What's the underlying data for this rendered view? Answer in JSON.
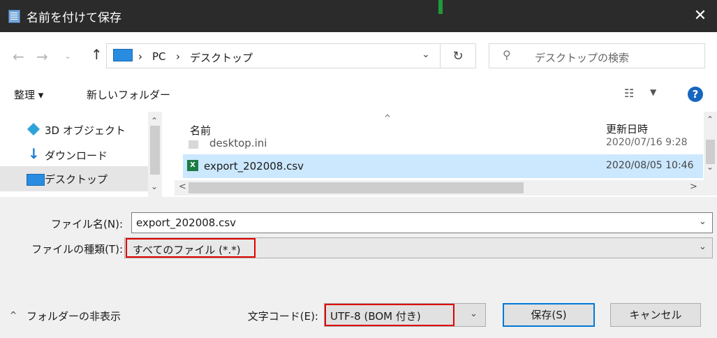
{
  "window": {
    "title": "名前を付けて保存",
    "close_label": "✕"
  },
  "address": {
    "crumbs": [
      "PC",
      "デスクトップ"
    ],
    "separator": "›"
  },
  "search": {
    "placeholder": "デスクトップの検索"
  },
  "toolbar": {
    "organize": "整理 ▾",
    "new_folder": "新しいフォルダー",
    "help": "?"
  },
  "nav_items": [
    {
      "label": "3D オブジェクト",
      "icon": "cube-3d-icon"
    },
    {
      "label": "ダウンロード",
      "icon": "download-icon"
    },
    {
      "label": "デスクトップ",
      "icon": "desktop-icon",
      "selected": true
    }
  ],
  "file_list": {
    "columns": {
      "name": "名前",
      "date": "更新日時"
    },
    "rows": [
      {
        "name": "desktop.ini",
        "date": "2020/07/16 9:28"
      },
      {
        "name": "export_202008.csv",
        "date": "2020/08/05 10:46",
        "selected": true
      }
    ]
  },
  "form": {
    "filename_label": "ファイル名(N):",
    "filename_value": "export_202008.csv",
    "filetype_label": "ファイルの種類(T):",
    "filetype_value": "すべてのファイル (*.*)",
    "hide_folders": "フォルダーの非表示",
    "encoding_label": "文字コード(E):",
    "encoding_value": "UTF-8 (BOM 付き)",
    "save": "保存(S)",
    "cancel": "キャンセル"
  },
  "colors": {
    "accent": "#0078d7",
    "highlight": "#e00000",
    "selection": "#cce8ff"
  }
}
